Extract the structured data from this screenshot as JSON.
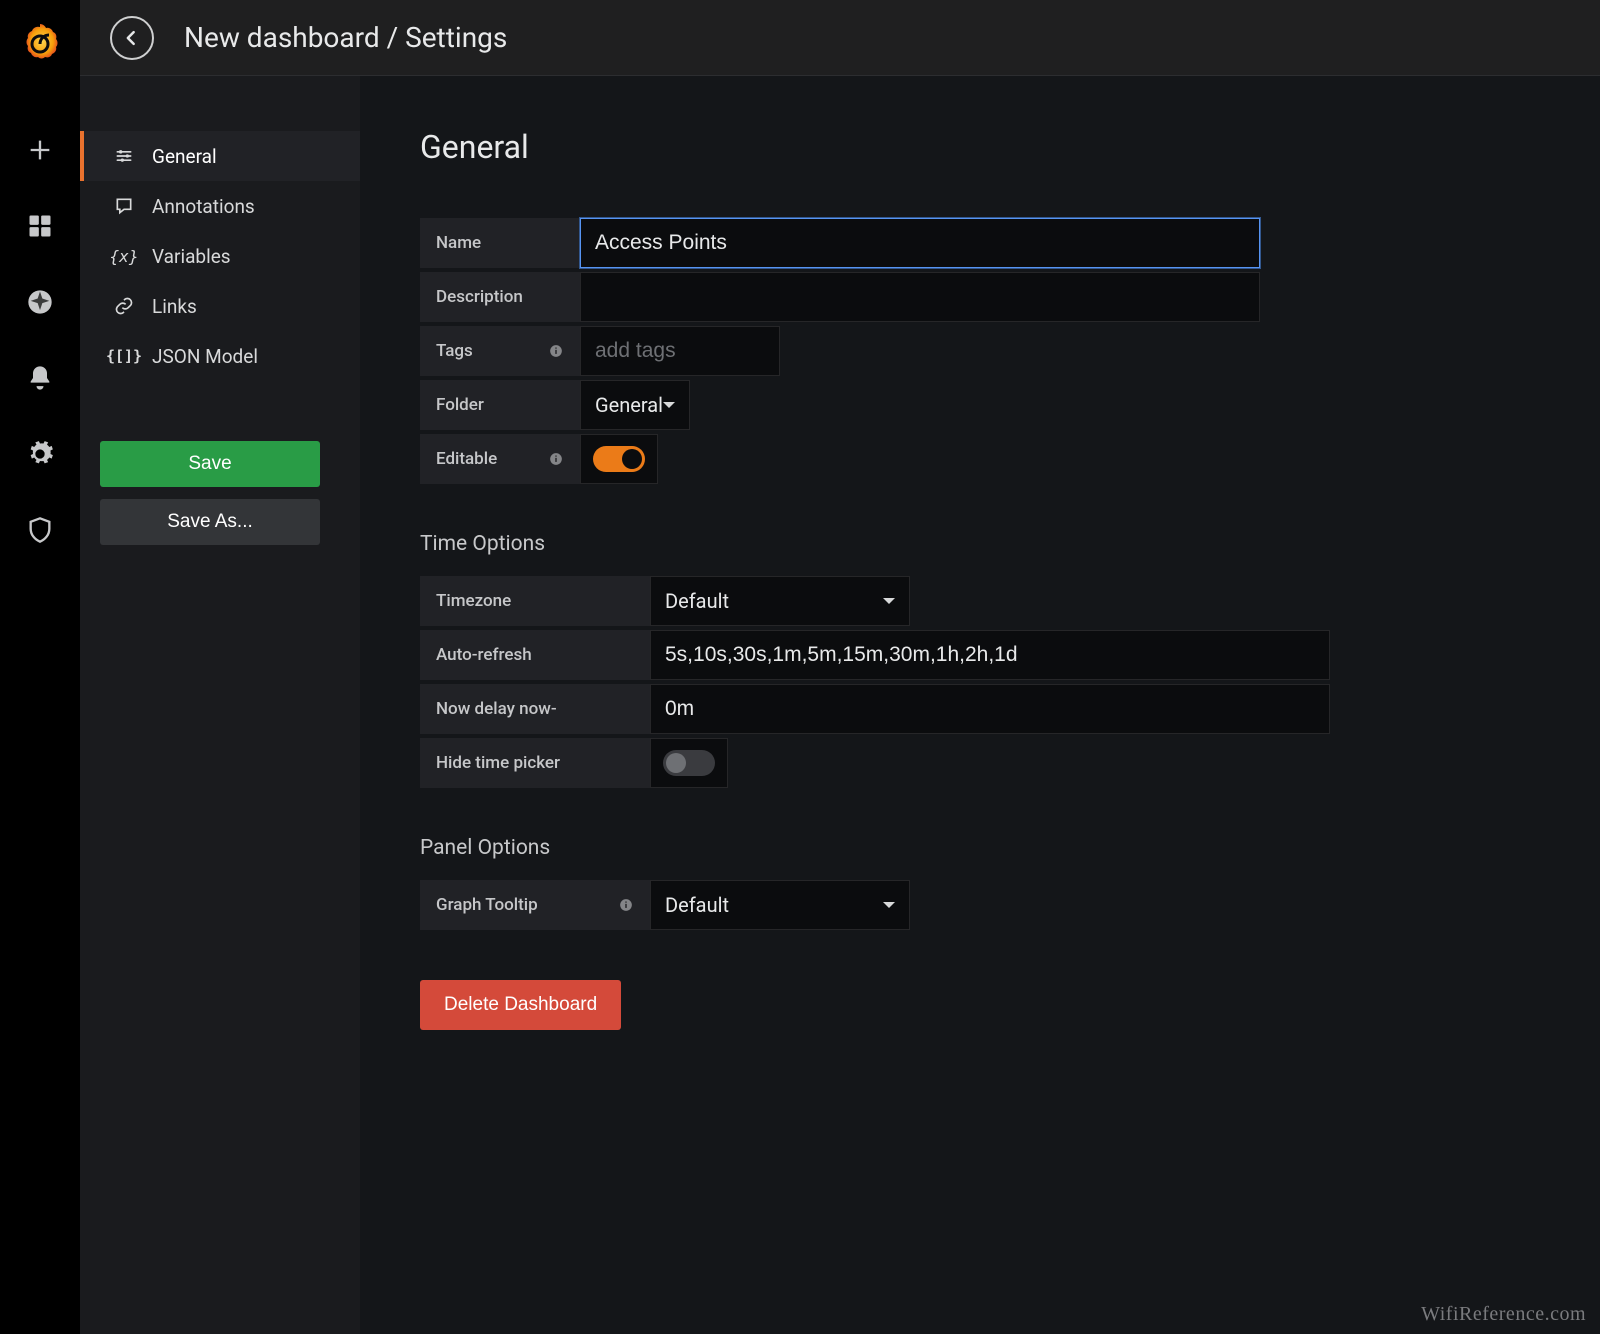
{
  "header": {
    "title": "New dashboard / Settings"
  },
  "settingsNav": {
    "items": [
      {
        "label": "General",
        "icon": "sliders",
        "active": true
      },
      {
        "label": "Annotations",
        "icon": "comment",
        "active": false
      },
      {
        "label": "Variables",
        "icon": "braces-x",
        "active": false
      },
      {
        "label": "Links",
        "icon": "link",
        "active": false
      },
      {
        "label": "JSON Model",
        "icon": "code-json",
        "active": false
      }
    ],
    "saveLabel": "Save",
    "saveAsLabel": "Save As..."
  },
  "general": {
    "heading": "General",
    "nameLabel": "Name",
    "nameValue": "Access Points",
    "descriptionLabel": "Description",
    "descriptionValue": "",
    "tagsLabel": "Tags",
    "tagsPlaceholder": "add tags",
    "folderLabel": "Folder",
    "folderValue": "General",
    "editableLabel": "Editable",
    "editableOn": true
  },
  "timeOptions": {
    "heading": "Time Options",
    "timezoneLabel": "Timezone",
    "timezoneValue": "Default",
    "autoRefreshLabel": "Auto-refresh",
    "autoRefreshValue": "5s,10s,30s,1m,5m,15m,30m,1h,2h,1d",
    "nowDelayLabel": "Now delay now-",
    "nowDelayValue": "0m",
    "hideTimePickerLabel": "Hide time picker",
    "hideTimePickerOn": false
  },
  "panelOptions": {
    "heading": "Panel Options",
    "graphTooltipLabel": "Graph Tooltip",
    "graphTooltipValue": "Default"
  },
  "deleteLabel": "Delete Dashboard",
  "watermark": "WifiReference.com"
}
